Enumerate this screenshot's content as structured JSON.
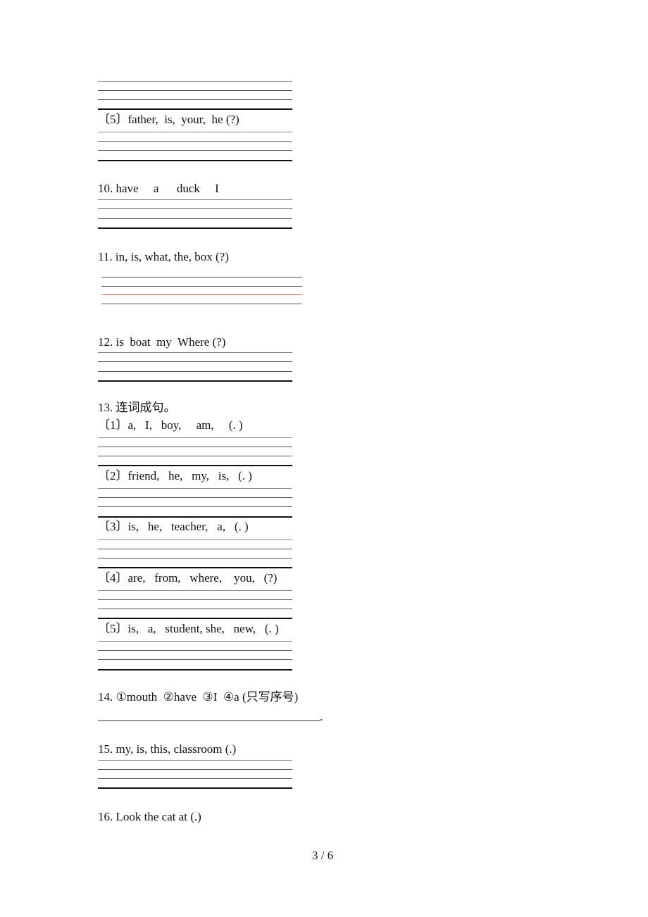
{
  "document": {
    "page_indicator": "3 / 6",
    "items": [
      {
        "id": "prev-5",
        "label": "〔5〕father,  is,  your,  he (?)"
      },
      {
        "id": "q10",
        "label": "10. have     a      duck     I"
      },
      {
        "id": "q11",
        "label": "11. in, is, what, the, box (?)"
      },
      {
        "id": "q12",
        "label": "12. is  boat  my  Where (?)"
      },
      {
        "id": "q13",
        "label": "13. 连词成句。",
        "sub_items": [
          {
            "label": "〔1〕a,   I,   boy,     am,     (. )"
          },
          {
            "label": "〔2〕friend,   he,   my,   is,   (. )"
          },
          {
            "label": "〔3〕is,   he,   teacher,   a,   (. )"
          },
          {
            "label": "〔4〕are,   from,   where,    you,   (?)"
          },
          {
            "label": "〔5〕is,   a,   student, she,   new,   (. )"
          }
        ]
      },
      {
        "id": "q14",
        "label": "14. ①mouth  ②have  ③I  ④a (只写序号)",
        "answer_suffix": "."
      },
      {
        "id": "q15",
        "label": "15. my, is, this, classroom (.)"
      },
      {
        "id": "q16",
        "label": "16. Look the cat at (.)"
      }
    ]
  }
}
